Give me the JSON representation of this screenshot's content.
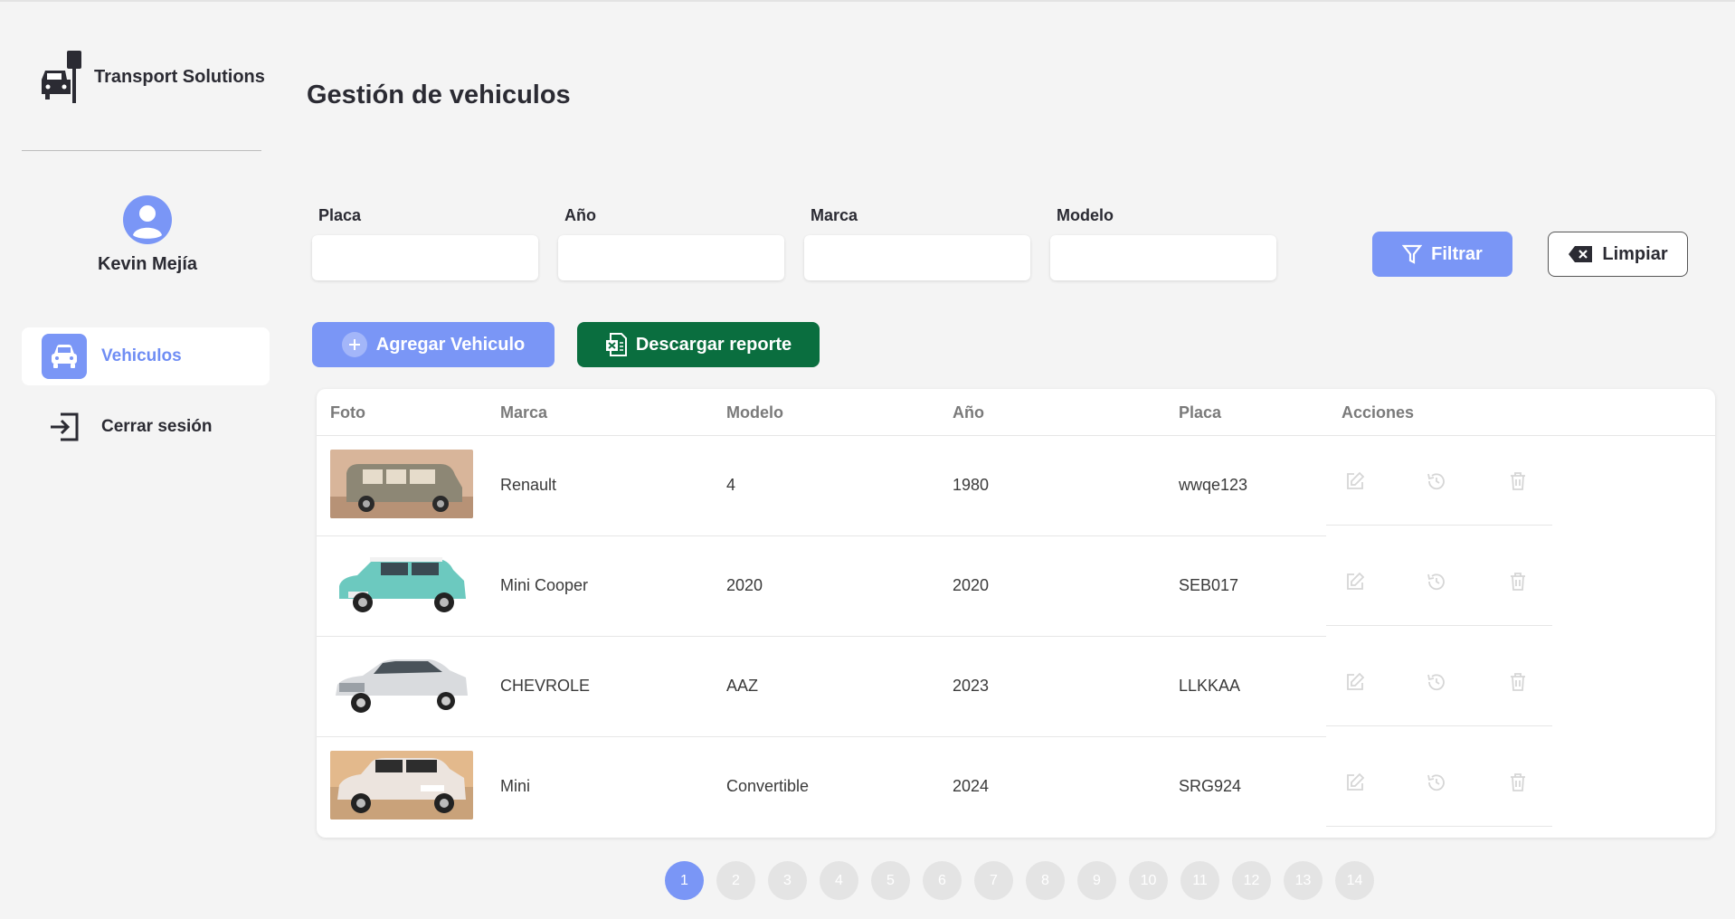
{
  "app": {
    "name": "Transport Solutions"
  },
  "user": {
    "name": "Kevin Mejía"
  },
  "nav": {
    "vehiculos": "Vehiculos",
    "logout": "Cerrar sesión"
  },
  "page": {
    "title": "Gestión de vehiculos"
  },
  "filters": {
    "placa": "Placa",
    "anio": "Año",
    "marca": "Marca",
    "modelo": "Modelo"
  },
  "buttons": {
    "filtrar": "Filtrar",
    "limpiar": "Limpiar",
    "agregar": "Agregar Vehiculo",
    "reporte": "Descargar reporte"
  },
  "table": {
    "headers": {
      "foto": "Foto",
      "marca": "Marca",
      "modelo": "Modelo",
      "anio": "Año",
      "placa": "Placa",
      "acciones": "Acciones"
    },
    "rows": [
      {
        "marca": "Renault",
        "modelo": "4",
        "anio": "1980",
        "placa": "wwqe123"
      },
      {
        "marca": "Mini Cooper",
        "modelo": "2020",
        "anio": "2020",
        "placa": "SEB017"
      },
      {
        "marca": "CHEVROLE",
        "modelo": "AAZ",
        "anio": "2023",
        "placa": "LLKKAA"
      },
      {
        "marca": "Mini",
        "modelo": "Convertible",
        "anio": "2024",
        "placa": "SRG924"
      }
    ]
  },
  "pagination": {
    "pages": [
      "1",
      "2",
      "3",
      "4",
      "5",
      "6",
      "7",
      "8",
      "9",
      "10",
      "11",
      "12",
      "13",
      "14"
    ],
    "current": "1"
  },
  "colors": {
    "accent": "#7a96f6",
    "excel": "#0a6e3f",
    "background": "#f4f4f4"
  }
}
